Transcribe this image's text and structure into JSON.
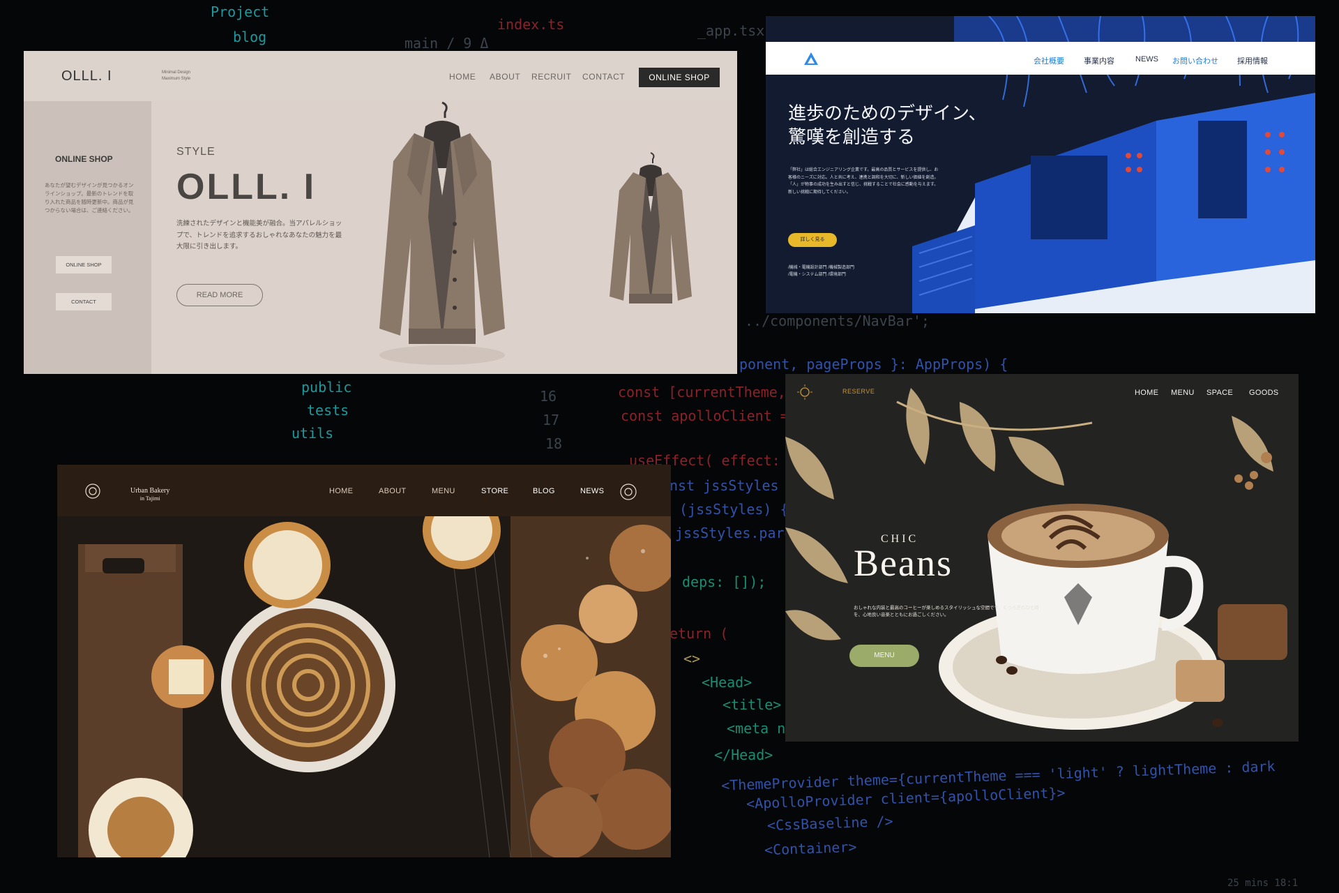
{
  "code_overlay": {
    "lines": [
      {
        "text": "Project",
        "cls": "c-cyan"
      },
      {
        "text": "blog",
        "cls": "c-cyan"
      },
      {
        "text": "main / 9 Δ",
        "cls": "c-gray"
      },
      {
        "text": "index.ts",
        "cls": "c-red"
      },
      {
        "text": "_app.tsx",
        "cls": "c-gray"
      },
      {
        "text": "../components/NavBar';",
        "cls": "c-gray"
      },
      {
        "text": "ponent, pageProps }: AppProps) {",
        "cls": "c-blue"
      },
      {
        "text": "public",
        "cls": "c-cyan"
      },
      {
        "text": "tests",
        "cls": "c-cyan"
      },
      {
        "text": "utils",
        "cls": "c-cyan"
      },
      {
        "text": "16",
        "cls": "c-gray"
      },
      {
        "text": "17",
        "cls": "c-gray"
      },
      {
        "text": "18",
        "cls": "c-gray"
      },
      {
        "text": "const [currentTheme,",
        "cls": "c-red"
      },
      {
        "text": "const apolloClient =",
        "cls": "c-red"
      },
      {
        "text": "useEffect( effect: ()",
        "cls": "c-red"
      },
      {
        "text": "nst jssStyles",
        "cls": "c-blue"
      },
      {
        "text": "(jssStyles) {",
        "cls": "c-blue"
      },
      {
        "text": "jssStyles.pare",
        "cls": "c-blue"
      },
      {
        "text": "deps: []);",
        "cls": "c-teal"
      },
      {
        "text": "eturn (",
        "cls": "c-red"
      },
      {
        "text": "<>",
        "cls": "c-yellow"
      },
      {
        "text": "<Head>",
        "cls": "c-teal"
      },
      {
        "text": "<title>",
        "cls": "c-teal"
      },
      {
        "text": "<meta n",
        "cls": "c-teal"
      },
      {
        "text": "</Head>",
        "cls": "c-teal"
      },
      {
        "text": "<ThemeProvider theme={currentTheme === 'light' ? lightTheme : dark",
        "cls": "c-blue"
      },
      {
        "text": "<ApolloProvider client={apolloClient}>",
        "cls": "c-blue"
      },
      {
        "text": "<CssBaseline />",
        "cls": "c-blue"
      },
      {
        "text": "<Container>",
        "cls": "c-blue"
      },
      {
        "text": "25 mins  18:1",
        "cls": "c-gray"
      }
    ]
  },
  "olll": {
    "logo": "OLLL. I",
    "tagline_1": "Minimal Design",
    "tagline_2": "Maximum Style",
    "nav": [
      "HOME",
      "ABOUT",
      "RECRUIT",
      "CONTACT"
    ],
    "shop_button": "ONLINE SHOP",
    "sidebar_title": "ONLINE SHOP",
    "sidebar_text": "あなたが望むデザインが見つかるオンラインショップ。最新のトレンドを取り入れた商品を随時更新中。商品が見つからない場合は、ご連絡ください。",
    "sidebar_button_1": "ONLINE SHOP",
    "sidebar_button_2": "CONTACT",
    "eyebrow": "STYLE",
    "heading": "OLLL. I",
    "description": "洗練されたデザインと機能美が融合。当アパレルショップで、トレンドを追求するおしゃれなあなたの魅力を最大限に引き出します。",
    "read_more": "READ MORE",
    "colors": {
      "bg": "#ddd2cb",
      "dark": "#2a2a2a",
      "jacket": "#8a7869"
    }
  },
  "engineering": {
    "nav": [
      "会社概要",
      "事業内容",
      "NEWS",
      "お問い合わせ",
      "採用情報"
    ],
    "headline_1": "進歩のためのデザイン、",
    "headline_2": "驚嘆を創造する",
    "body": "「弊社」は総合エンジニアリング企業です。最高の品質とサービスを提供し、お客様のニーズに対応。人と共に考え、連携と調和を大切に、新しい価値を創造。「人」が物事の成功を生み出すと信じ、挑戦することで社会に感動を与えます。新しい挑戦に期待してください。",
    "cta": "詳しく見る",
    "departments": [
      "/機械・電機設計部門 /機械製造部門",
      "/電機・システム部門 /環境部門"
    ],
    "colors": {
      "accent": "#1f7dd6",
      "button": "#e6b82a",
      "bg": "#111b30"
    }
  },
  "bakery": {
    "name_line_1": "Urban Bakery",
    "name_line_2": "in Tajimi",
    "nav": [
      "HOME",
      "ABOUT",
      "MENU",
      "STORE",
      "BLOG",
      "NEWS"
    ],
    "colors": {
      "bar": "#2a1d14",
      "crust": "#c98d46"
    }
  },
  "cafe": {
    "reserve": "RESERVE",
    "nav": [
      "HOME",
      "MENU",
      "SPACE",
      "GOODS"
    ],
    "eyebrow": "CHIC",
    "title": "Beans",
    "body": "おしゃれな内装と最高のコーヒーが楽しめるスタイリッシュな空間です。くつろぎのひと時を、心地良い音楽とともにお過ごしください。",
    "menu_button": "MENU",
    "colors": {
      "button": "#9aab6a",
      "gold": "#c7963a",
      "bg": "#232322"
    }
  }
}
